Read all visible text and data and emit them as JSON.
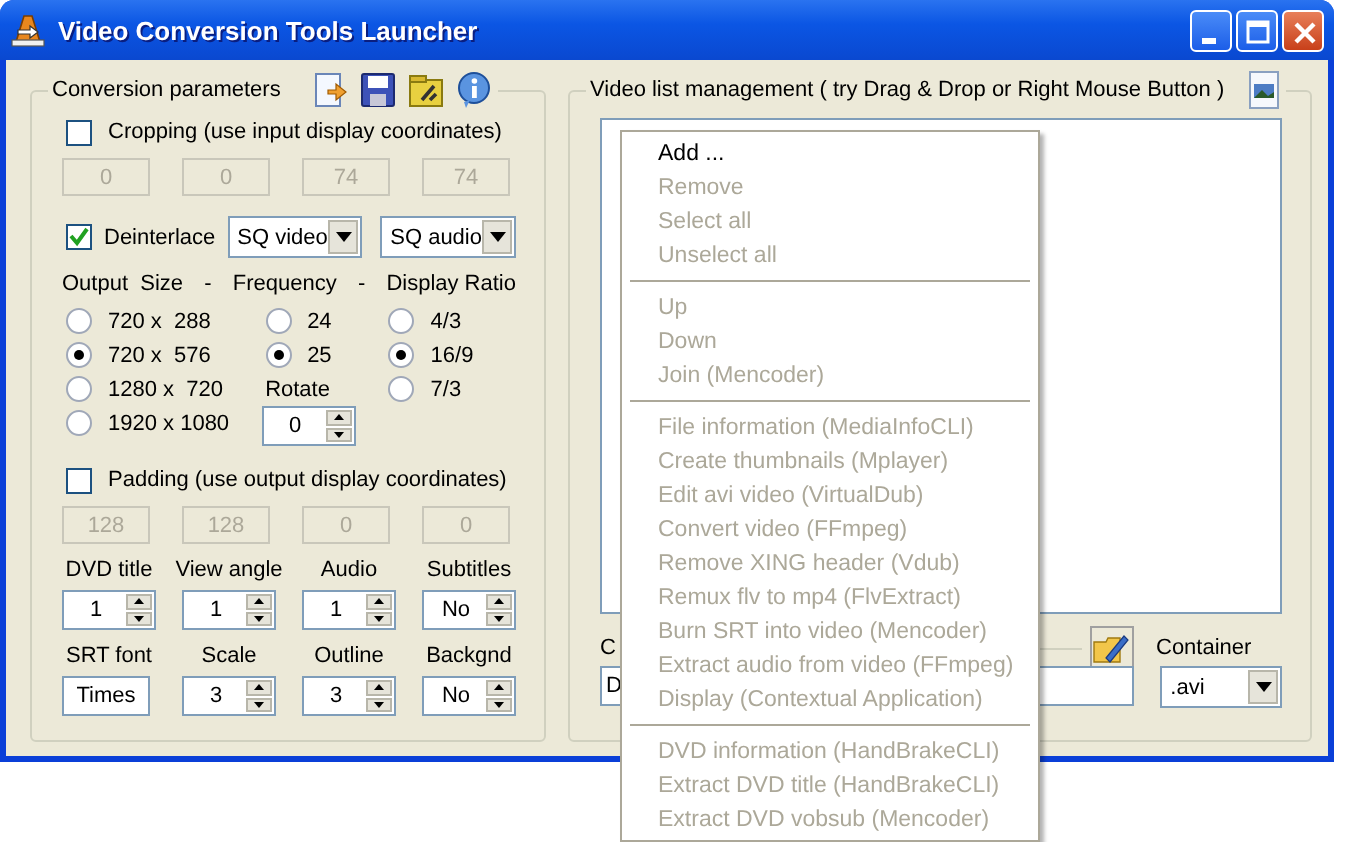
{
  "window": {
    "title": "Video Conversion Tools Launcher"
  },
  "conversion_parameters": {
    "title": "Conversion parameters",
    "cropping": {
      "label": "Cropping  (use input display coordinates)",
      "checked": false,
      "values": [
        "0",
        "0",
        "74",
        "74"
      ]
    },
    "deinterlace": {
      "label": "Deinterlace",
      "checked": true,
      "video_quality": "SQ video",
      "audio_quality": "SQ audio"
    },
    "headers": [
      "Output  Size",
      "-",
      "Frequency",
      "-",
      "Display Ratio"
    ],
    "output_sizes": [
      {
        "label": "720 x  288",
        "selected": false
      },
      {
        "label": "720 x  576",
        "selected": true
      },
      {
        "label": "1280 x  720",
        "selected": false
      },
      {
        "label": "1920 x 1080",
        "selected": false
      }
    ],
    "frequencies": [
      {
        "label": "24",
        "selected": false
      },
      {
        "label": "25",
        "selected": true
      }
    ],
    "display_ratios": [
      {
        "label": "4/3",
        "selected": false
      },
      {
        "label": "16/9",
        "selected": true
      },
      {
        "label": "7/3",
        "selected": false
      }
    ],
    "rotate": {
      "label": "Rotate",
      "value": "0"
    },
    "padding": {
      "label": "Padding (use output display coordinates)",
      "checked": false,
      "values": [
        "128",
        "128",
        "0",
        "0"
      ]
    },
    "dvd": [
      {
        "label": "DVD title",
        "value": "1",
        "kind": "spinner"
      },
      {
        "label": "View angle",
        "value": "1",
        "kind": "spinner"
      },
      {
        "label": "Audio",
        "value": "1",
        "kind": "spinner"
      },
      {
        "label": "Subtitles",
        "value": "No",
        "kind": "spinner"
      }
    ],
    "subtitle_style": [
      {
        "label": "SRT font",
        "value": "Times",
        "kind": "text"
      },
      {
        "label": "Scale",
        "value": "3",
        "kind": "spinner"
      },
      {
        "label": "Outline",
        "value": "3",
        "kind": "spinner"
      },
      {
        "label": "Backgnd",
        "value": "No",
        "kind": "spinner"
      }
    ]
  },
  "video_list": {
    "title": "Video list management ( try Drag & Drop or Right Mouse Button )",
    "output_label": "C",
    "output_value": "D",
    "container_label": "Container",
    "container": ".avi"
  },
  "context_menu": {
    "groups": [
      [
        {
          "label": "Add ...",
          "disabled": false
        },
        {
          "label": "Remove",
          "disabled": true
        },
        {
          "label": "Select all",
          "disabled": true
        },
        {
          "label": "Unselect all",
          "disabled": true
        }
      ],
      [
        {
          "label": "Up",
          "disabled": true
        },
        {
          "label": "Down",
          "disabled": true
        },
        {
          "label": "Join (Mencoder)",
          "disabled": true
        }
      ],
      [
        {
          "label": "File information (MediaInfoCLI)",
          "disabled": true
        },
        {
          "label": "Create thumbnails (Mplayer)",
          "disabled": true
        },
        {
          "label": "Edit avi video (VirtualDub)",
          "disabled": true
        },
        {
          "label": "Convert video (FFmpeg)",
          "disabled": true
        },
        {
          "label": "Remove XING header (Vdub)",
          "disabled": true
        },
        {
          "label": "Remux flv to mp4 (FlvExtract)",
          "disabled": true
        },
        {
          "label": "Burn SRT into video (Mencoder)",
          "disabled": true
        },
        {
          "label": "Extract audio from video (FFmpeg)",
          "disabled": true
        },
        {
          "label": "Display (Contextual Application)",
          "disabled": true
        }
      ],
      [
        {
          "label": "DVD information (HandBrakeCLI)",
          "disabled": true
        },
        {
          "label": "Extract DVD title (HandBrakeCLI)",
          "disabled": true
        },
        {
          "label": "Extract DVD vobsub (Mencoder)",
          "disabled": true
        }
      ]
    ]
  }
}
